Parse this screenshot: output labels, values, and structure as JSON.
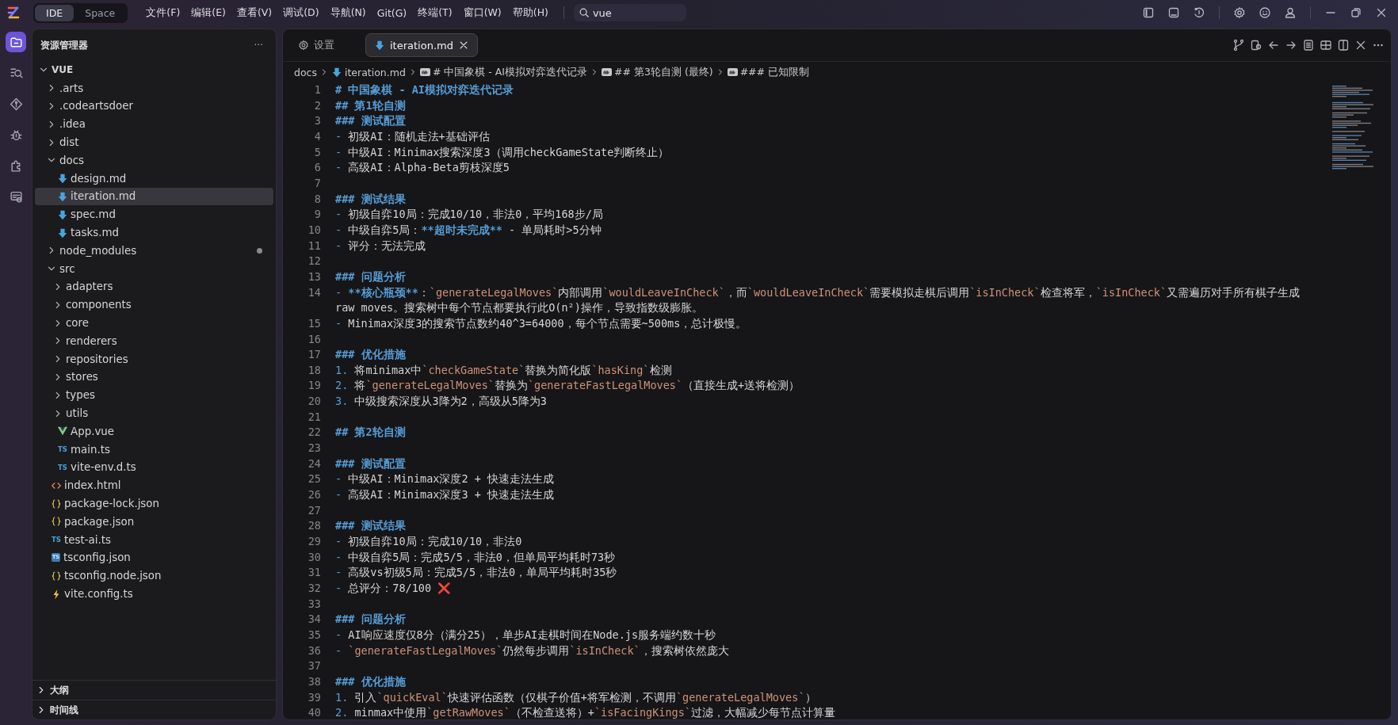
{
  "title_bar": {
    "mode_toggle": [
      {
        "label": "IDE",
        "selected": true
      },
      {
        "label": "Space",
        "selected": false
      }
    ],
    "menus": [
      "文件(F)",
      "编辑(E)",
      "查看(V)",
      "调试(D)",
      "导航(N)",
      "Git(G)",
      "终端(T)",
      "窗口(W)",
      "帮助(H)"
    ],
    "search": {
      "value": "vue"
    }
  },
  "activity_bar": [
    {
      "kind": "files",
      "selected": true
    },
    {
      "kind": "search",
      "selected": false
    },
    {
      "kind": "source-control",
      "selected": false
    },
    {
      "kind": "debug",
      "selected": false
    },
    {
      "kind": "extensions",
      "selected": false
    },
    {
      "kind": "chat",
      "selected": false
    }
  ],
  "explorer": {
    "title": "资源管理器",
    "more": "···",
    "tree": [
      {
        "name": "VUE",
        "kind": "folder",
        "expanded": true,
        "selected": false,
        "children": [
          {
            "name": ".arts",
            "kind": "folder",
            "expanded": false,
            "selected": false
          },
          {
            "name": ".codeartsdoer",
            "kind": "folder",
            "expanded": false,
            "selected": false
          },
          {
            "name": ".idea",
            "kind": "folder",
            "expanded": false,
            "selected": false
          },
          {
            "name": "dist",
            "kind": "folder",
            "expanded": false,
            "selected": false
          },
          {
            "name": "docs",
            "kind": "folder",
            "expanded": true,
            "selected": false,
            "children": [
              {
                "name": "design.md",
                "kind": "markdown",
                "selected": false
              },
              {
                "name": "iteration.md",
                "kind": "markdown",
                "selected": true
              },
              {
                "name": "spec.md",
                "kind": "markdown",
                "selected": false
              },
              {
                "name": "tasks.md",
                "kind": "markdown",
                "selected": false
              }
            ]
          },
          {
            "name": "node_modules",
            "kind": "folder",
            "expanded": false,
            "selected": false,
            "dot": true
          },
          {
            "name": "src",
            "kind": "folder",
            "expanded": true,
            "selected": false,
            "children": [
              {
                "name": "adapters",
                "kind": "folder",
                "expanded": false,
                "selected": false
              },
              {
                "name": "components",
                "kind": "folder",
                "expanded": false,
                "selected": false
              },
              {
                "name": "core",
                "kind": "folder",
                "expanded": false,
                "selected": false
              },
              {
                "name": "renderers",
                "kind": "folder",
                "expanded": false,
                "selected": false
              },
              {
                "name": "repositories",
                "kind": "folder",
                "expanded": false,
                "selected": false
              },
              {
                "name": "stores",
                "kind": "folder",
                "expanded": false,
                "selected": false
              },
              {
                "name": "types",
                "kind": "folder",
                "expanded": false,
                "selected": false
              },
              {
                "name": "utils",
                "kind": "folder",
                "expanded": false,
                "selected": false
              },
              {
                "name": "App.vue",
                "kind": "vue",
                "selected": false
              },
              {
                "name": "main.ts",
                "kind": "ts",
                "icon_text": "TS",
                "selected": false
              },
              {
                "name": "vite-env.d.ts",
                "kind": "ts",
                "icon_text": "TS",
                "selected": false
              }
            ]
          },
          {
            "name": "index.html",
            "kind": "html",
            "selected": false
          },
          {
            "name": "package-lock.json",
            "kind": "json",
            "selected": false
          },
          {
            "name": "package.json",
            "kind": "json",
            "selected": false
          },
          {
            "name": "test-ai.ts",
            "kind": "ts",
            "icon_text": "TS",
            "selected": false
          },
          {
            "name": "tsconfig.json",
            "kind": "tsconfig",
            "icon_text": "TS",
            "selected": false
          },
          {
            "name": "tsconfig.node.json",
            "kind": "json",
            "selected": false
          },
          {
            "name": "vite.config.ts",
            "kind": "vite",
            "selected": false
          }
        ]
      }
    ],
    "sections": [
      {
        "label": "大纲",
        "expanded": false
      },
      {
        "label": "时间线",
        "expanded": false
      }
    ]
  },
  "tabs": [
    {
      "label": "设置",
      "kind": "settings",
      "selected": false
    },
    {
      "label": "iteration.md",
      "kind": "markdown",
      "selected": true
    }
  ],
  "breadcrumb": [
    {
      "text": "docs",
      "kind": "folder"
    },
    {
      "text": "iteration.md",
      "kind": "markdown"
    },
    {
      "text": "# 中国象棋 - AI模拟对弈迭代记录",
      "kind": "symbol"
    },
    {
      "text": "## 第3轮自测 (最终)",
      "kind": "symbol"
    },
    {
      "text": "### 已知限制",
      "kind": "symbol"
    }
  ],
  "editor_lines": [
    {
      "number": "1",
      "segments": [
        {
          "kind": "heading",
          "text": "# 中国象棋 - AI模拟对弈迭代记录"
        }
      ]
    },
    {
      "number": "2",
      "segments": [
        {
          "kind": "heading",
          "text": "## 第1轮自测"
        }
      ]
    },
    {
      "number": "3",
      "segments": [
        {
          "kind": "heading",
          "text": "### 测试配置"
        }
      ]
    },
    {
      "number": "4",
      "segments": [
        {
          "kind": "marker",
          "text": "-"
        },
        {
          "kind": "plain",
          "text": " 初级AI：随机走法+基础评估"
        }
      ]
    },
    {
      "number": "5",
      "segments": [
        {
          "kind": "marker",
          "text": "-"
        },
        {
          "kind": "plain",
          "text": " 中级AI：Minimax搜索深度3（调用checkGameState判断终止）"
        }
      ]
    },
    {
      "number": "6",
      "segments": [
        {
          "kind": "marker",
          "text": "-"
        },
        {
          "kind": "plain",
          "text": " 高级AI：Alpha-Beta剪枝深度5"
        }
      ]
    },
    {
      "number": "7"
    },
    {
      "number": "8",
      "segments": [
        {
          "kind": "heading",
          "text": "### 测试结果"
        }
      ]
    },
    {
      "number": "9",
      "segments": [
        {
          "kind": "marker",
          "text": "-"
        },
        {
          "kind": "plain",
          "text": " 初级自弈10局：完成10/10，非法0，平均168步/局"
        }
      ]
    },
    {
      "number": "10",
      "segments": [
        {
          "kind": "marker",
          "text": "-"
        },
        {
          "kind": "plain",
          "text": " 中级自弈5局："
        },
        {
          "kind": "bold",
          "text": "**超时未完成**"
        },
        {
          "kind": "plain",
          "text": " - 单局耗时>5分钟"
        }
      ]
    },
    {
      "number": "11",
      "segments": [
        {
          "kind": "marker",
          "text": "-"
        },
        {
          "kind": "plain",
          "text": " 评分：无法完成"
        }
      ]
    },
    {
      "number": "12"
    },
    {
      "number": "13",
      "segments": [
        {
          "kind": "heading",
          "text": "### 问题分析"
        }
      ]
    },
    {
      "number": "14",
      "segments": [
        {
          "kind": "marker",
          "text": "- "
        },
        {
          "kind": "bold",
          "text": "**核心瓶颈**"
        },
        {
          "kind": "plain",
          "text": "："
        },
        {
          "kind": "code",
          "text": "`generateLegalMoves`"
        },
        {
          "kind": "plain",
          "text": "内部调用"
        },
        {
          "kind": "code",
          "text": "`wouldLeaveInCheck`"
        },
        {
          "kind": "plain",
          "text": "，而"
        },
        {
          "kind": "code",
          "text": "`wouldLeaveInCheck`"
        },
        {
          "kind": "plain",
          "text": "需要模拟走棋后调用"
        },
        {
          "kind": "code",
          "text": "`isInCheck`"
        },
        {
          "kind": "plain",
          "text": "检查将军，"
        },
        {
          "kind": "code",
          "text": "`isInCheck`"
        },
        {
          "kind": "plain",
          "text": "又需遍历对手所有棋子生成raw moves。搜索树中每个节点都要执行此O(n²)操作，导致指数级膨胀。"
        }
      ]
    },
    {
      "number": "15",
      "segments": [
        {
          "kind": "marker",
          "text": "-"
        },
        {
          "kind": "plain",
          "text": " Minimax深度3的搜索节点数约40^3=64000，每个节点需要~500ms，总计极慢。"
        }
      ]
    },
    {
      "number": "16"
    },
    {
      "number": "17",
      "segments": [
        {
          "kind": "heading",
          "text": "### 优化措施"
        }
      ]
    },
    {
      "number": "18",
      "segments": [
        {
          "kind": "marker",
          "text": "1."
        },
        {
          "kind": "plain",
          "text": " 将minimax中"
        },
        {
          "kind": "code",
          "text": "`checkGameState`"
        },
        {
          "kind": "plain",
          "text": "替换为简化版"
        },
        {
          "kind": "code",
          "text": "`hasKing`"
        },
        {
          "kind": "plain",
          "text": "检测"
        }
      ]
    },
    {
      "number": "19",
      "segments": [
        {
          "kind": "marker",
          "text": "2."
        },
        {
          "kind": "plain",
          "text": " 将"
        },
        {
          "kind": "code",
          "text": "`generateLegalMoves`"
        },
        {
          "kind": "plain",
          "text": "替换为"
        },
        {
          "kind": "code",
          "text": "`generateFastLegalMoves`"
        },
        {
          "kind": "plain",
          "text": "（直接生成+送将检测）"
        }
      ]
    },
    {
      "number": "20",
      "segments": [
        {
          "kind": "marker",
          "text": "3."
        },
        {
          "kind": "plain",
          "text": " 中级搜索深度从3降为2，高级从5降为3"
        }
      ]
    },
    {
      "number": "21"
    },
    {
      "number": "22",
      "segments": [
        {
          "kind": "heading",
          "text": "## 第2轮自测"
        }
      ]
    },
    {
      "number": "23"
    },
    {
      "number": "24",
      "segments": [
        {
          "kind": "heading",
          "text": "### 测试配置"
        }
      ]
    },
    {
      "number": "25",
      "segments": [
        {
          "kind": "marker",
          "text": "-"
        },
        {
          "kind": "plain",
          "text": " 中级AI：Minimax深度2 + 快速走法生成"
        }
      ]
    },
    {
      "number": "26",
      "segments": [
        {
          "kind": "marker",
          "text": "-"
        },
        {
          "kind": "plain",
          "text": " 高级AI：Minimax深度3 + 快速走法生成"
        }
      ]
    },
    {
      "number": "27"
    },
    {
      "number": "28",
      "segments": [
        {
          "kind": "heading",
          "text": "### 测试结果"
        }
      ]
    },
    {
      "number": "29",
      "segments": [
        {
          "kind": "marker",
          "text": "-"
        },
        {
          "kind": "plain",
          "text": " 初级自弈10局：完成10/10，非法0"
        }
      ]
    },
    {
      "number": "30",
      "segments": [
        {
          "kind": "marker",
          "text": "-"
        },
        {
          "kind": "plain",
          "text": " 中级自弈5局：完成5/5，非法0，但单局平均耗时73秒"
        }
      ]
    },
    {
      "number": "31",
      "segments": [
        {
          "kind": "marker",
          "text": "-"
        },
        {
          "kind": "plain",
          "text": " 高级vs初级5局：完成5/5，非法0，单局平均耗时35秒"
        }
      ]
    },
    {
      "number": "32",
      "segments": [
        {
          "kind": "marker",
          "text": "-"
        },
        {
          "kind": "plain",
          "text": " 总评分：78/100 "
        },
        {
          "kind": "emoji",
          "text": "❌"
        }
      ]
    },
    {
      "number": "33"
    },
    {
      "number": "34",
      "segments": [
        {
          "kind": "heading",
          "text": "### 问题分析"
        }
      ]
    },
    {
      "number": "35",
      "segments": [
        {
          "kind": "marker",
          "text": "-"
        },
        {
          "kind": "plain",
          "text": " AI响应速度仅8分（满分25），单步AI走棋时间在Node.js服务端约数十秒"
        }
      ]
    },
    {
      "number": "36",
      "segments": [
        {
          "kind": "marker",
          "text": "- "
        },
        {
          "kind": "code",
          "text": "`generateFastLegalMoves`"
        },
        {
          "kind": "plain",
          "text": "仍然每步调用"
        },
        {
          "kind": "code",
          "text": "`isInCheck`"
        },
        {
          "kind": "plain",
          "text": "，搜索树依然庞大"
        }
      ]
    },
    {
      "number": "37"
    },
    {
      "number": "38",
      "segments": [
        {
          "kind": "heading",
          "text": "### 优化措施"
        }
      ]
    },
    {
      "number": "39",
      "segments": [
        {
          "kind": "marker",
          "text": "1."
        },
        {
          "kind": "plain",
          "text": " 引入"
        },
        {
          "kind": "code",
          "text": "`quickEval`"
        },
        {
          "kind": "plain",
          "text": "快速评估函数（仅棋子价值+将军检测，不调用"
        },
        {
          "kind": "code",
          "text": "`generateLegalMoves`"
        },
        {
          "kind": "plain",
          "text": "）"
        }
      ]
    },
    {
      "number": "40",
      "segments": [
        {
          "kind": "marker",
          "text": "2."
        },
        {
          "kind": "plain",
          "text": " minmax中使用"
        },
        {
          "kind": "code",
          "text": "`getRawMoves`"
        },
        {
          "kind": "plain",
          "text": "（不检查送将）+"
        },
        {
          "kind": "code",
          "text": "`isFacingKings`"
        },
        {
          "kind": "plain",
          "text": "过滤，大幅减少每节点计算量"
        }
      ]
    }
  ]
}
